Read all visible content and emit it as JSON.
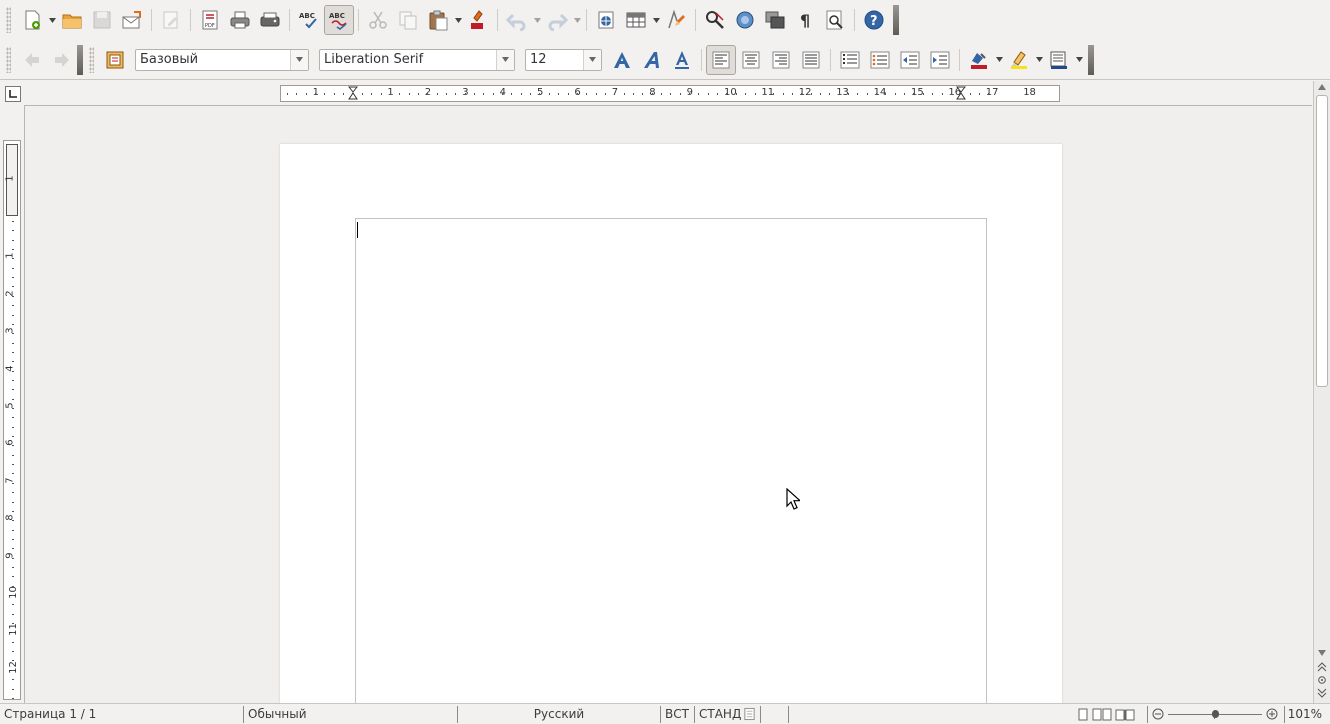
{
  "formatting": {
    "paragraph_style": "Базовый",
    "font_name": "Liberation Serif",
    "font_size": "12"
  },
  "ruler": {
    "horizontal_ticks": [
      "1",
      "1",
      "2",
      "3",
      "4",
      "5",
      "6",
      "7",
      "8",
      "9",
      "10",
      "11",
      "12",
      "13",
      "14",
      "15",
      "16",
      "17",
      "18"
    ],
    "vertical_ticks": [
      "1",
      "1",
      "2",
      "3",
      "4",
      "5",
      "6",
      "7",
      "8",
      "9",
      "10",
      "11",
      "12"
    ]
  },
  "statusbar": {
    "page": "Страница 1 / 1",
    "style": "Обычный",
    "language": "Русский",
    "insert_mode": "ВСТ",
    "selection_mode": "СТАНД",
    "zoom": "101%"
  },
  "zoom_level": 101,
  "colors": {
    "font_color": "#c01c28",
    "highlight_color": "#f6e21a",
    "accent": "#3465a4"
  }
}
